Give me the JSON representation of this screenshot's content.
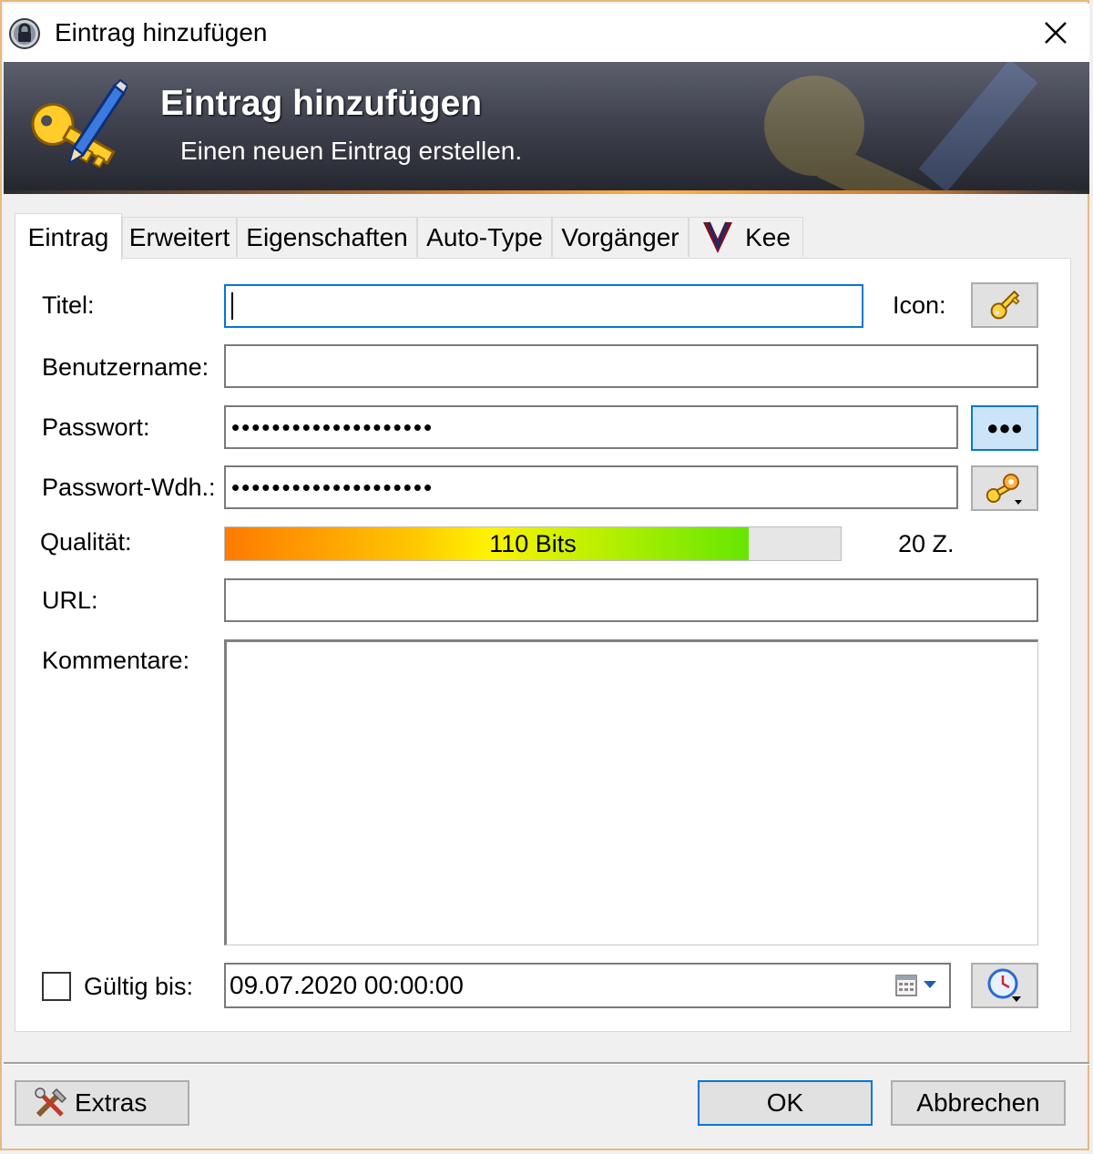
{
  "window": {
    "title": "Eintrag hinzufügen",
    "close_glyph": "✕"
  },
  "banner": {
    "title": "Eintrag hinzufügen",
    "subtitle": "Einen neuen Eintrag erstellen."
  },
  "tabs": [
    {
      "label": "Eintrag",
      "active": true
    },
    {
      "label": "Erweitert"
    },
    {
      "label": "Eigenschaften"
    },
    {
      "label": "Auto-Type"
    },
    {
      "label": "Vorgänger"
    },
    {
      "label": "Kee",
      "icon": "kee-logo-icon"
    }
  ],
  "form": {
    "title_label": "Titel:",
    "title_value": "",
    "icon_label": "Icon:",
    "username_label": "Benutzername:",
    "username_value": "",
    "password_label": "Passwort:",
    "password_value": "••••••••••••••••••••",
    "password_toggle_label": "●●●",
    "repeat_label": "Passwort-Wdh.:",
    "repeat_value": "••••••••••••••••••••",
    "quality_label": "Qualität:",
    "quality_text": "110 Bits",
    "quality_fraction": 0.85,
    "char_count": "20 Z.",
    "url_label": "URL:",
    "url_value": "",
    "notes_label": "Kommentare:",
    "notes_value": "",
    "expires_label": "Gültig bis:",
    "expires_checked": false,
    "expires_value": "09.07.2020 00:00:00"
  },
  "footer": {
    "extras_label": "Extras",
    "ok_label": "OK",
    "cancel_label": "Abbrechen"
  },
  "colors": {
    "accent": "#0078d7",
    "banner_dark": "#25272f",
    "banner_orange": "#ffb04a"
  }
}
